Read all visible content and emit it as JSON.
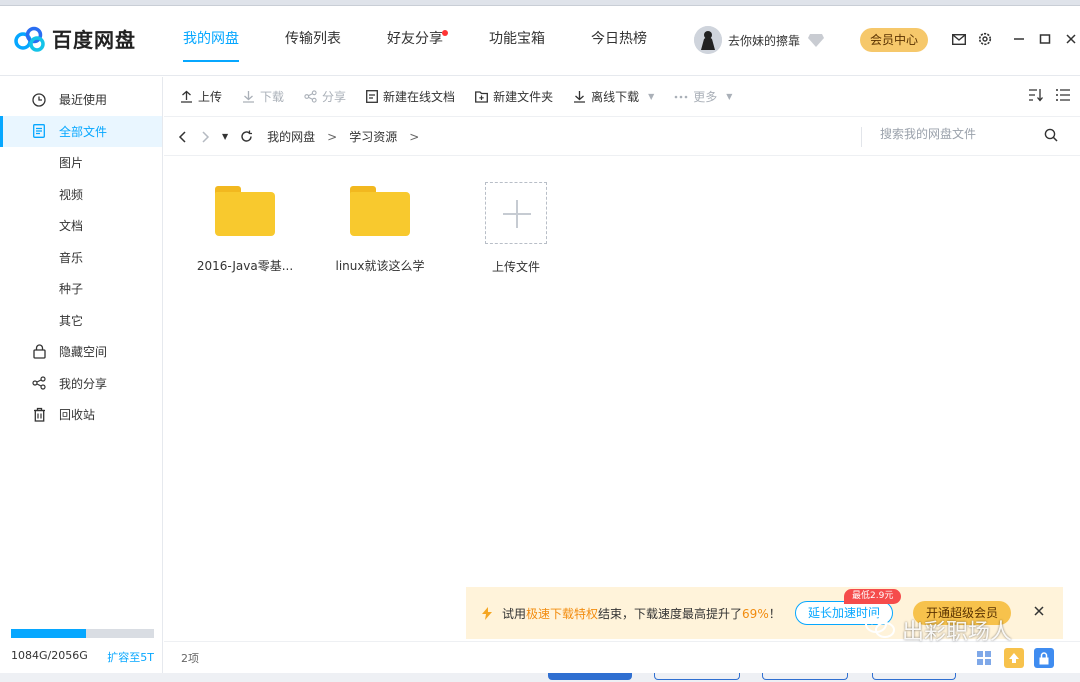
{
  "app": {
    "logo_text": "百度网盘"
  },
  "nav": {
    "items": [
      {
        "label": "我的网盘"
      },
      {
        "label": "传输列表"
      },
      {
        "label": "好友分享"
      },
      {
        "label": "功能宝箱"
      },
      {
        "label": "今日热榜"
      }
    ]
  },
  "user": {
    "name": "去你妹的擦靠",
    "vip_label": "会员中心"
  },
  "sidebar": {
    "items": [
      {
        "label": "最近使用",
        "icon": "clock-icon"
      },
      {
        "label": "全部文件",
        "icon": "file-icon"
      },
      {
        "label": "图片"
      },
      {
        "label": "视频"
      },
      {
        "label": "文档"
      },
      {
        "label": "音乐"
      },
      {
        "label": "种子"
      },
      {
        "label": "其它"
      },
      {
        "label": "隐藏空间",
        "icon": "lock-icon"
      },
      {
        "label": "我的分享",
        "icon": "share-icon"
      },
      {
        "label": "回收站",
        "icon": "trash-icon"
      }
    ],
    "quota": {
      "used": "1084G/2056G",
      "expand": "扩容至5T",
      "fraction": 0.527
    }
  },
  "toolbar": {
    "upload": "上传",
    "download": "下载",
    "share": "分享",
    "new_doc": "新建在线文档",
    "new_folder": "新建文件夹",
    "offline": "离线下载",
    "more": "更多"
  },
  "path": {
    "crumbs": [
      "我的网盘",
      "学习资源"
    ],
    "search_placeholder": "搜索我的网盘文件"
  },
  "files": [
    {
      "name": "2016-Java零基...",
      "type": "folder"
    },
    {
      "name": "linux就该这么学",
      "type": "folder"
    },
    {
      "name": "上传文件",
      "type": "upload"
    }
  ],
  "status": {
    "count": "2项"
  },
  "promo": {
    "text_a": "试用",
    "text_highlight": "极速下载特权",
    "text_b": "结束，下载速度最高提升了",
    "percent": "69%",
    "text_c": "！",
    "extend_label": "延长加速时间",
    "badge": "最低2.9元",
    "vip_label": "开通超级会员"
  },
  "watermark": {
    "text": "出彩职场人"
  },
  "colors": {
    "accent": "#06a7ff",
    "vip": "#f6c86b",
    "folder": "#f8c92e",
    "promo_bg": "#fff3da"
  }
}
